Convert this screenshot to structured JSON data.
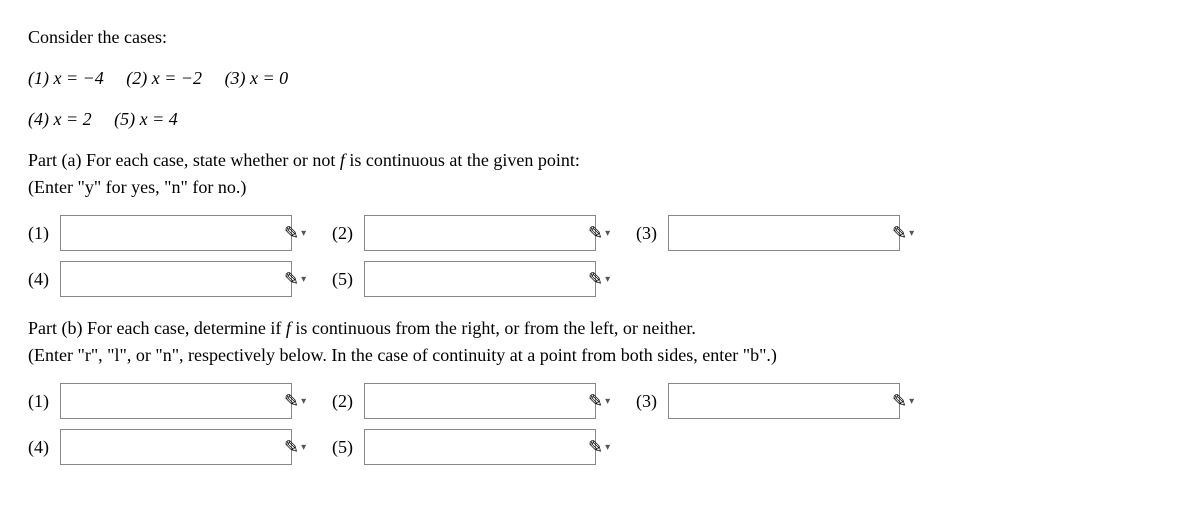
{
  "intro": {
    "consider": "Consider the cases:",
    "case1": "(1) x = −4",
    "case2": "(2) x = −2",
    "case3": "(3) x = 0",
    "case4": "(4) x = 2",
    "case5": "(5) x = 4"
  },
  "partA": {
    "prompt_pre": "Part (a) For each case, state whether or not ",
    "f": "f",
    "prompt_post": " is continuous at the given point:",
    "hint": "(Enter \"y\" for yes, \"n\" for no.)",
    "labels": {
      "l1": "(1)",
      "l2": "(2)",
      "l3": "(3)",
      "l4": "(4)",
      "l5": "(5)"
    },
    "inputs": {
      "v1": "",
      "v2": "",
      "v3": "",
      "v4": "",
      "v5": ""
    }
  },
  "partB": {
    "prompt_pre": "Part (b) For each case, determine if ",
    "f": "f",
    "prompt_post": " is continuous from the right, or from the left, or neither.",
    "hint": "(Enter \"r\", \"l\", or \"n\", respectively below. In the case of continuity at a point from both sides, enter \"b\".)",
    "labels": {
      "l1": "(1)",
      "l2": "(2)",
      "l3": "(3)",
      "l4": "(4)",
      "l5": "(5)"
    },
    "inputs": {
      "v1": "",
      "v2": "",
      "v3": "",
      "v4": "",
      "v5": ""
    }
  },
  "icons": {
    "pencil": "✎",
    "caret": "▾"
  }
}
